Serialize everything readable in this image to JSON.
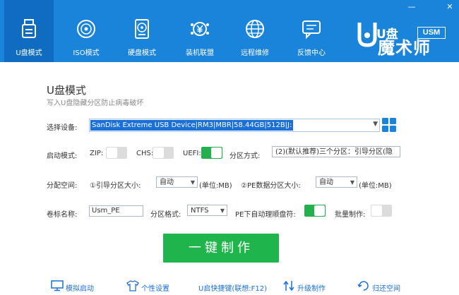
{
  "window": {
    "minimize": "—",
    "close": "✕"
  },
  "nav": [
    {
      "label": "U盘模式",
      "icon": "usb-drive-icon",
      "active": true
    },
    {
      "label": "ISO模式",
      "icon": "disc-icon",
      "active": false
    },
    {
      "label": "硬盘模式",
      "icon": "hard-disk-icon",
      "active": false
    },
    {
      "label": "装机联盟",
      "icon": "yen-coin-icon",
      "active": false
    },
    {
      "label": "远程维修",
      "icon": "globe-icon",
      "active": false
    },
    {
      "label": "反馈中心",
      "icon": "chat-icon",
      "active": false
    }
  ],
  "logo": {
    "badge": "USM",
    "u": "U盘",
    "name": "魔术师"
  },
  "main": {
    "title": "U盘模式",
    "subtitle": "写入U盘隐藏分区防止病毒破坏"
  },
  "device": {
    "label": "选择设备:",
    "value": "SanDisk Extreme USB Device|RM3|MBR|58.44GB|512B|J:"
  },
  "boot": {
    "label": "启动模式:",
    "zip": {
      "label": "ZIP:",
      "on": false
    },
    "chs": {
      "label": "CHS:",
      "on": false
    },
    "uefi": {
      "label": "UEFI:",
      "on": true
    },
    "partition_label": "分区方式:",
    "partition_value": "(2)(默认推荐)三个分区：引导分区(隐"
  },
  "alloc": {
    "label": "分配空间:",
    "boot_label": "①引导分区大小:",
    "boot_value": "自动",
    "boot_unit": "(单位:MB)",
    "pe_label": "②PE数据分区大小:",
    "pe_value": "自动",
    "pe_unit": "(单位:MB)"
  },
  "volume": {
    "label": "卷标名称:",
    "value": "Usm_PE",
    "format_label": "分区格式:",
    "format_value": "NTFS",
    "auto_label": "PE下自动理顺盘符:",
    "auto_on": true,
    "batch_label": "批量制作:",
    "batch_on": false
  },
  "make_button": "一键制作",
  "footer": [
    {
      "label": "模拟启动",
      "icon": "monitor-icon"
    },
    {
      "label": "个性设置",
      "icon": "tshirt-icon"
    },
    {
      "label": "U启快捷键(联想:F12)",
      "icon": "shortcut-icon"
    },
    {
      "label": "升级制作",
      "icon": "upgrade-arrows-icon"
    },
    {
      "label": "归还空间",
      "icon": "restore-icon"
    }
  ]
}
